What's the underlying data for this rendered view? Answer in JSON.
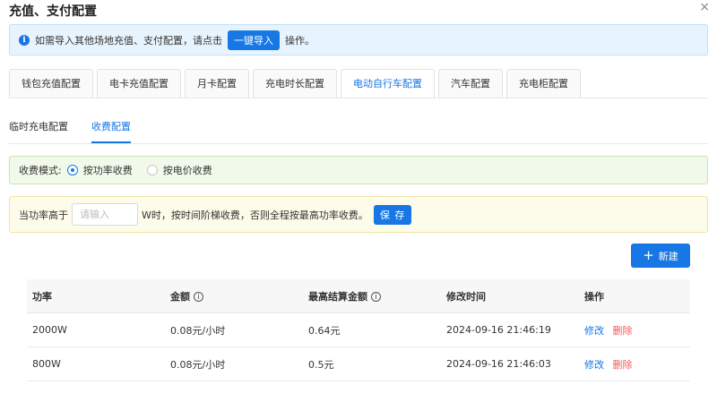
{
  "dialog": {
    "title": "充值、支付配置",
    "close_glyph": "×"
  },
  "info": {
    "text_before": "如需导入其他场地充值、支付配置，请点击",
    "import_label": "一键导入",
    "text_after": "操作。",
    "icon_glyph": "i"
  },
  "tabs": [
    {
      "label": "钱包充值配置"
    },
    {
      "label": "电卡充值配置"
    },
    {
      "label": "月卡配置"
    },
    {
      "label": "充电时长配置"
    },
    {
      "label": "电动自行车配置"
    },
    {
      "label": "汽车配置"
    },
    {
      "label": "充电柜配置"
    }
  ],
  "subtabs": [
    {
      "label": "临时充电配置"
    },
    {
      "label": "收费配置"
    }
  ],
  "mode": {
    "label": "收费模式:",
    "options": [
      {
        "label": "按功率收费",
        "checked": true
      },
      {
        "label": "按电价收费",
        "checked": false
      }
    ]
  },
  "power": {
    "label": "当功率高于",
    "placeholder": "请输入",
    "suffix": "W时，按时间阶梯收费，否则全程按最高功率收费。",
    "save_label": "保 存"
  },
  "actions": {
    "new_label": "新建",
    "plus_glyph": "+"
  },
  "table": {
    "columns": [
      "功率",
      "金额",
      "最高结算金额",
      "修改时间",
      "操作"
    ],
    "rows": [
      {
        "power": "2000W",
        "amount": "0.08元/小时",
        "max": "0.64元",
        "time": "2024-09-16 21:46:19",
        "edit": "修改",
        "delete": "删除"
      },
      {
        "power": "800W",
        "amount": "0.08元/小时",
        "max": "0.5元",
        "time": "2024-09-16 21:46:03",
        "edit": "修改",
        "delete": "删除"
      }
    ],
    "question_glyph": "i"
  },
  "colors": {
    "accent": "#1677e5",
    "danger": "#f05a5a",
    "info_bg": "#e8f4fd",
    "mode_bg": "#f1f9ea",
    "power_bg": "#fdfbe9"
  }
}
